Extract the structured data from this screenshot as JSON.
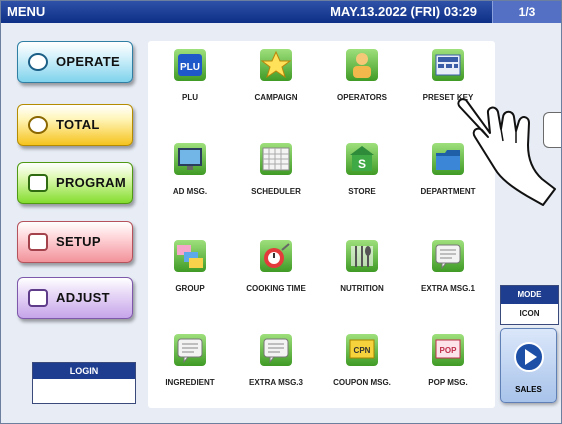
{
  "topbar": {
    "title": "MENU",
    "datetime": "MAY.13.2022 (FRI)  03:29",
    "page": "1/3"
  },
  "left_menu": [
    {
      "label": "OPERATE",
      "icon": "operate-icon"
    },
    {
      "label": "TOTAL",
      "icon": "total-icon"
    },
    {
      "label": "PROGRAM",
      "icon": "program-icon"
    },
    {
      "label": "SETUP",
      "icon": "setup-icon"
    },
    {
      "label": "ADJUST",
      "icon": "adjust-icon"
    }
  ],
  "login": {
    "label": "LOGIN"
  },
  "grid": {
    "items": [
      {
        "label": "PLU",
        "icon": "plu-icon"
      },
      {
        "label": "CAMPAIGN",
        "icon": "star-icon"
      },
      {
        "label": "OPERATORS",
        "icon": "operator-icon"
      },
      {
        "label": "PRESET KEY",
        "icon": "preset-keyboard-icon"
      },
      {
        "label": "AD MSG.",
        "icon": "monitor-icon"
      },
      {
        "label": "SCHEDULER",
        "icon": "calendar-icon"
      },
      {
        "label": "STORE",
        "icon": "store-icon"
      },
      {
        "label": "DEPARTMENT",
        "icon": "folder-icon"
      },
      {
        "label": "GROUP",
        "icon": "group-icon"
      },
      {
        "label": "COOKING TIME",
        "icon": "timer-icon"
      },
      {
        "label": "NUTRITION",
        "icon": "cutlery-icon"
      },
      {
        "label": "EXTRA MSG.1",
        "icon": "message-icon"
      },
      {
        "label": "INGREDIENT",
        "icon": "ingredient-icon"
      },
      {
        "label": "EXTRA MSG.3",
        "icon": "message-icon"
      },
      {
        "label": "COUPON MSG.",
        "icon": "coupon-icon"
      },
      {
        "label": "POP MSG.",
        "icon": "pop-icon"
      }
    ]
  },
  "mode": {
    "label": "MODE",
    "value": "ICON"
  },
  "sales": {
    "label": "SALES",
    "icon": "play-icon"
  },
  "colors": {
    "topbar": "#173a94",
    "operate": "#7fd3ec",
    "total": "#f6c31e",
    "program": "#84dd2f",
    "setup": "#f2929a",
    "adjust": "#c6a4e9",
    "icon_green": "#4fae2a"
  }
}
